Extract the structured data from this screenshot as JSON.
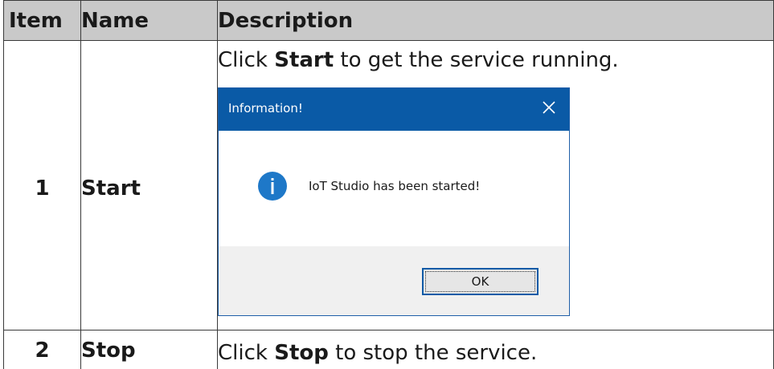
{
  "table": {
    "headers": [
      "Item",
      "Name",
      "Description"
    ],
    "rows": [
      {
        "item": "1",
        "name": "Start",
        "desc_pre": "Click ",
        "desc_bold": "Start",
        "desc_post": " to get the service running."
      },
      {
        "item": "2",
        "name": "Stop",
        "desc_pre": "Click ",
        "desc_bold": "Stop",
        "desc_post": " to stop the service."
      }
    ]
  },
  "dialog": {
    "title": "Information!",
    "message": "IoT Studio has been started!",
    "ok_label": "OK",
    "icon": "info-icon",
    "close_icon": "close-icon"
  },
  "colors": {
    "header_bg": "#c9c9c9",
    "titlebar": "#0a5aa6",
    "info_icon": "#1e78c8",
    "dialog_footer": "#f0f0f0"
  }
}
